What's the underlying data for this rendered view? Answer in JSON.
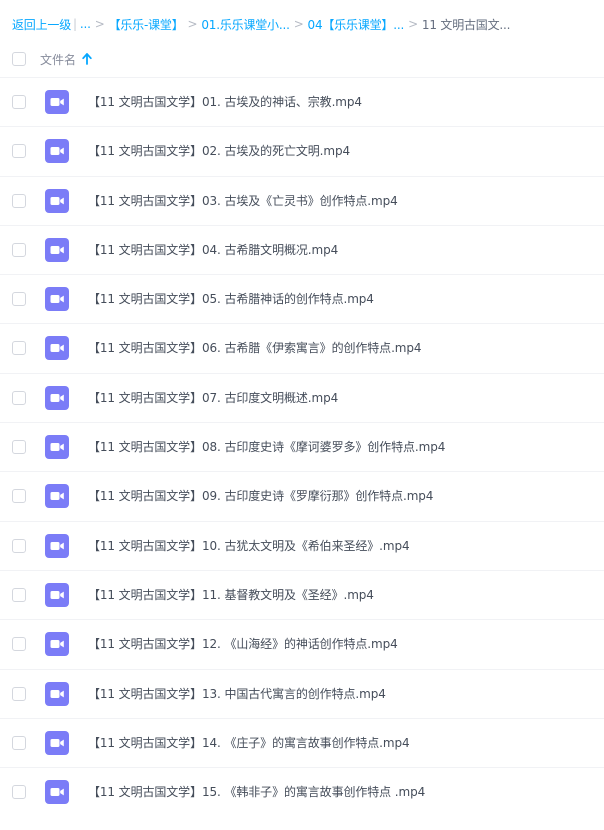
{
  "breadcrumb": {
    "back": "返回上一级",
    "pipe": "|",
    "ellipsis": "...",
    "sep": ">",
    "crumbs": [
      "【乐乐-课堂】",
      "01.乐乐课堂小...",
      "04【乐乐课堂】..."
    ],
    "current": "11 文明古国文..."
  },
  "header": {
    "column_label": "文件名",
    "sort_icon": "arrow-up-icon"
  },
  "colors": {
    "accent": "#06a7ff",
    "video_icon": "#7b7cf7"
  },
  "files": [
    {
      "name": "【11 文明古国文学】01. 古埃及的神话、宗教.mp4",
      "icon": "video-file-icon"
    },
    {
      "name": "【11 文明古国文学】02. 古埃及的死亡文明.mp4",
      "icon": "video-file-icon"
    },
    {
      "name": "【11 文明古国文学】03. 古埃及《亡灵书》创作特点.mp4",
      "icon": "video-file-icon"
    },
    {
      "name": "【11 文明古国文学】04. 古希腊文明概况.mp4",
      "icon": "video-file-icon"
    },
    {
      "name": "【11 文明古国文学】05. 古希腊神话的创作特点.mp4",
      "icon": "video-file-icon"
    },
    {
      "name": "【11 文明古国文学】06. 古希腊《伊索寓言》的创作特点.mp4",
      "icon": "video-file-icon"
    },
    {
      "name": "【11 文明古国文学】07. 古印度文明概述.mp4",
      "icon": "video-file-icon"
    },
    {
      "name": "【11 文明古国文学】08. 古印度史诗《摩诃婆罗多》创作特点.mp4",
      "icon": "video-file-icon"
    },
    {
      "name": "【11 文明古国文学】09. 古印度史诗《罗摩衍那》创作特点.mp4",
      "icon": "video-file-icon"
    },
    {
      "name": "【11 文明古国文学】10. 古犹太文明及《希伯来圣经》.mp4",
      "icon": "video-file-icon"
    },
    {
      "name": "【11 文明古国文学】11. 基督教文明及《圣经》.mp4",
      "icon": "video-file-icon"
    },
    {
      "name": "【11 文明古国文学】12. 《山海经》的神话创作特点.mp4",
      "icon": "video-file-icon"
    },
    {
      "name": "【11 文明古国文学】13. 中国古代寓言的创作特点.mp4",
      "icon": "video-file-icon"
    },
    {
      "name": "【11 文明古国文学】14. 《庄子》的寓言故事创作特点.mp4",
      "icon": "video-file-icon"
    },
    {
      "name": "【11 文明古国文学】15. 《韩非子》的寓言故事创作特点 .mp4",
      "icon": "video-file-icon"
    }
  ]
}
